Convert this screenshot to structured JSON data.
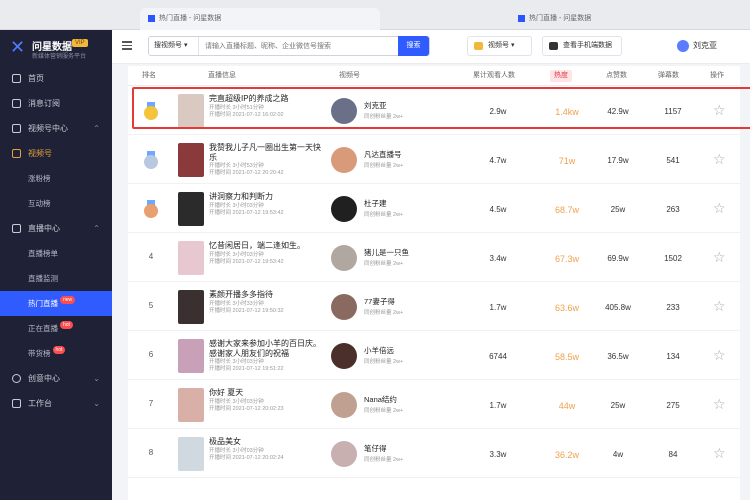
{
  "browser": {
    "tab1": "热门直播 - 问星数据",
    "tab2": "热门直播 - 问星数据"
  },
  "sidebar": {
    "brand": "问星数据",
    "brand_badge": "VIP",
    "brand_sub": "新媒体营销服务平台",
    "items": [
      {
        "label": "首页"
      },
      {
        "label": "消息订阅"
      },
      {
        "label": "视频号中心"
      },
      {
        "label": "视频号"
      },
      {
        "label": "涨粉榜"
      },
      {
        "label": "互动榜"
      },
      {
        "label": "直播中心"
      },
      {
        "label": "直播榜单"
      },
      {
        "label": "直播监测"
      },
      {
        "label": "热门直播",
        "badge": "new"
      },
      {
        "label": "正在直播",
        "badge": "hot"
      },
      {
        "label": "带货榜",
        "badge": "hot"
      },
      {
        "label": "创意中心"
      },
      {
        "label": "工作台"
      }
    ]
  },
  "header": {
    "search_select": "搜视频号",
    "search_placeholder": "请输入直播标题、昵称、企业微信号搜索",
    "search_btn": "搜索",
    "pill1": "视频号",
    "pill2": "查看手机端数据",
    "user": "刘克亚"
  },
  "table": {
    "headers": [
      "排名",
      "直播信息",
      "视频号",
      "累计观看人数",
      "热度",
      "点赞数",
      "弹幕数",
      "操作"
    ],
    "rows": [
      {
        "rank": "1",
        "title": "完直超级IP的养成之路",
        "meta1": "开播时长 3小时51分钟",
        "meta2": "开播时间 2021-07-12 16:02:02",
        "name": "刘克亚",
        "sub": "同创粉丝量 2w+",
        "views": "2.9w",
        "heat": "1.4kw",
        "likes": "42.9w",
        "bullets": "1157"
      },
      {
        "rank": "2",
        "title": "我赞我儿子凡一圈出生第一天快乐",
        "meta1": "开播时长 3小时53分钟",
        "meta2": "开播时间 2021-07-12 20:20:42",
        "name": "凡达直播号",
        "sub": "同创粉丝量 2w+",
        "views": "4.7w",
        "heat": "71w",
        "likes": "17.9w",
        "bullets": "541"
      },
      {
        "rank": "3",
        "title": "讲洞察力和判断力",
        "meta1": "开播时长 3小时03分钟",
        "meta2": "开播时间 2021-07-12 19:53:42",
        "name": "杜子建",
        "sub": "同创粉丝量 2w+",
        "views": "4.5w",
        "heat": "68.7w",
        "likes": "25w",
        "bullets": "263"
      },
      {
        "rank": "4",
        "title": "忆昔闲居日，端二逢如生。",
        "meta1": "开播时长 3小时03分钟",
        "meta2": "开播时间 2021-07-12 19:53:42",
        "name": "猪儿是一只鱼",
        "sub": "同创粉丝量 2w+",
        "views": "3.4w",
        "heat": "67.3w",
        "likes": "69.9w",
        "bullets": "1502"
      },
      {
        "rank": "5",
        "title": "素颜开播多多指待",
        "meta1": "开播时长 3小时33分钟",
        "meta2": "开播时间 2021-07-12 19:50:32",
        "name": "77妻子得",
        "sub": "同创粉丝量 2w+",
        "views": "1.7w",
        "heat": "63.6w",
        "likes": "405.8w",
        "bullets": "233"
      },
      {
        "rank": "6",
        "title": "感谢大家来参加小羊的百日庆。感谢家人朋友们的祝福",
        "meta1": "开播时长 3小时03分钟",
        "meta2": "开播时间 2021-07-12 19:51:22",
        "name": "小羊倍远",
        "sub": "同创粉丝量 2w+",
        "views": "6744",
        "heat": "58.5w",
        "likes": "36.5w",
        "bullets": "134"
      },
      {
        "rank": "7",
        "title": "你好 夏天",
        "meta1": "开播时长 3小时03分钟",
        "meta2": "开播时间 2021-07-12 20:02:23",
        "name": "Nana结约",
        "sub": "同创粉丝量 2w+",
        "views": "1.7w",
        "heat": "44w",
        "likes": "25w",
        "bullets": "275"
      },
      {
        "rank": "8",
        "title": "极品美女",
        "meta1": "开播时长 3小时03分钟",
        "meta2": "开播时间 2021-07-12 20:02:24",
        "name": "笔仔得",
        "sub": "同创粉丝量 2w+",
        "views": "3.3w",
        "heat": "36.2w",
        "likes": "4w",
        "bullets": "84"
      }
    ]
  },
  "colors": {
    "accent": "#2f5bff",
    "highlight": "#e53935",
    "heat": "#f0a04b"
  }
}
